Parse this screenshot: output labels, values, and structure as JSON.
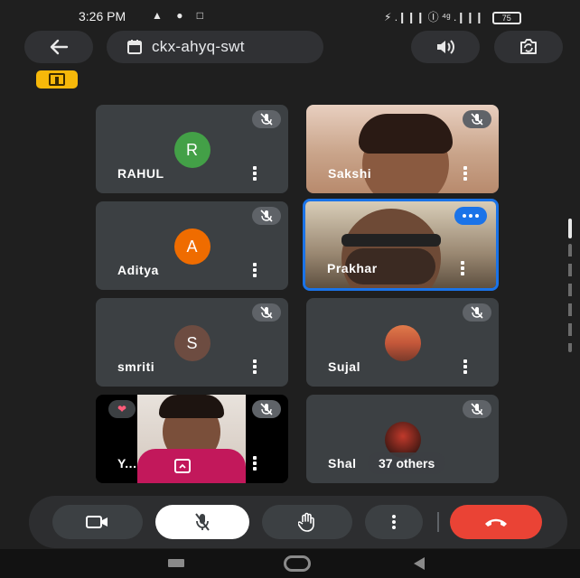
{
  "status_bar": {
    "time": "3:26 PM",
    "left_icons": "▲ ● □",
    "right_icons": "⚡ .❙❙❙ Ⓘ ⁴ᵍ .❙❙❙",
    "battery": "75"
  },
  "header": {
    "meeting_code": "ckx-ahyq-swt"
  },
  "participants": [
    {
      "name": "RAHUL",
      "initial": "R"
    },
    {
      "name": "Sakshi"
    },
    {
      "name": "Aditya",
      "initial": "A"
    },
    {
      "name": "Prakhar"
    },
    {
      "name": "smriti",
      "initial": "S"
    },
    {
      "name": "Sujal"
    },
    {
      "name": "Y..."
    },
    {
      "name": "Shal",
      "others": "37 others"
    }
  ],
  "colors": {
    "accent": "#1a73e8",
    "end_call": "#ea4335",
    "avatar_rahul": "#43a047",
    "avatar_aditya": "#ef6c00",
    "avatar_smriti": "#6d4c41",
    "host_badge": "#f6b80a"
  }
}
